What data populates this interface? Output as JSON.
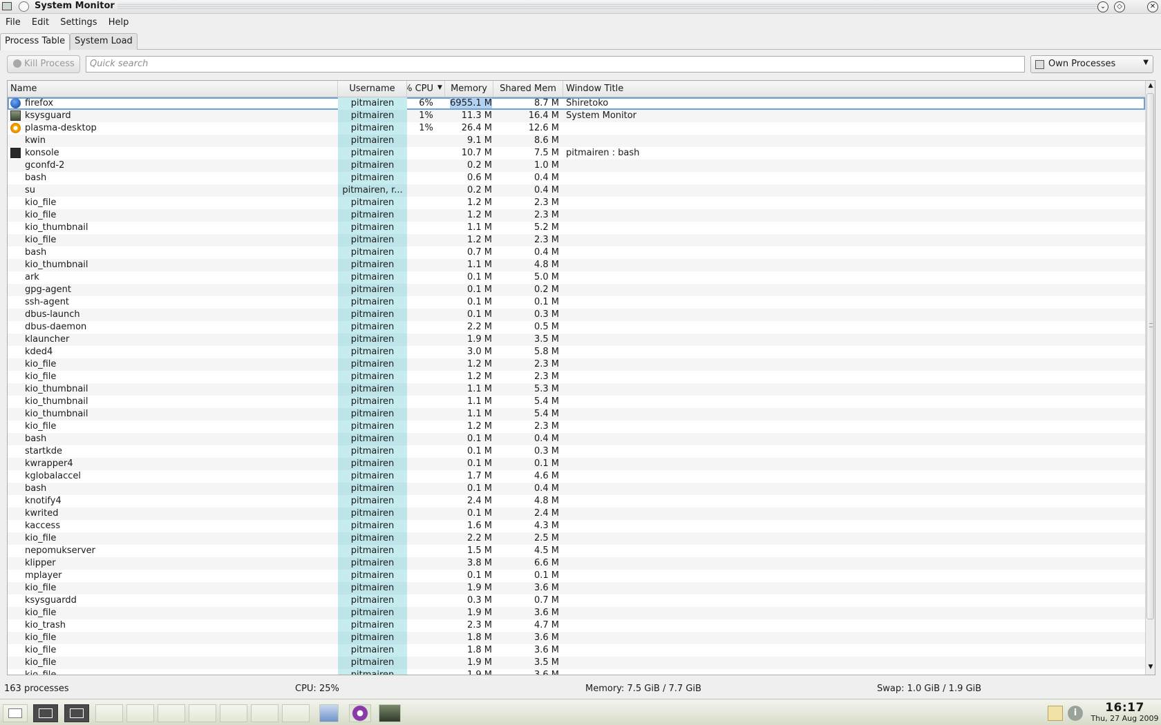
{
  "window": {
    "title": "System Monitor",
    "menu": [
      "File",
      "Edit",
      "Settings",
      "Help"
    ],
    "tabs": [
      "Process Table",
      "System Load"
    ]
  },
  "toolbar": {
    "kill_label": "Kill Process",
    "search_placeholder": "Quick search",
    "filter_value": "Own Processes"
  },
  "table": {
    "headers": {
      "name": "Name",
      "username": "Username",
      "cpu": "CPU %",
      "memory": "Memory",
      "shared": "Shared Mem",
      "window_title": "Window Title"
    },
    "rows": [
      {
        "icon": "firefox-icon",
        "name": "firefox",
        "user": "pitmairen",
        "cpu": "6%",
        "mem": "6955.1 M",
        "shm": "8.7 M",
        "title": "Shiretoko",
        "selected": true
      },
      {
        "icon": "ksysguard-icon",
        "name": "ksysguard",
        "user": "pitmairen",
        "cpu": "1%",
        "mem": "11.3 M",
        "shm": "16.4 M",
        "title": "System Monitor"
      },
      {
        "icon": "plasma-icon",
        "name": "plasma-desktop",
        "user": "pitmairen",
        "cpu": "1%",
        "mem": "26.4 M",
        "shm": "12.6 M",
        "title": ""
      },
      {
        "icon": "",
        "name": "kwin",
        "user": "pitmairen",
        "cpu": "",
        "mem": "9.1 M",
        "shm": "8.6 M",
        "title": ""
      },
      {
        "icon": "konsole-icon",
        "name": "konsole",
        "user": "pitmairen",
        "cpu": "",
        "mem": "10.7 M",
        "shm": "7.5 M",
        "title": "pitmairen : bash"
      },
      {
        "icon": "",
        "name": "gconfd-2",
        "user": "pitmairen",
        "cpu": "",
        "mem": "0.2 M",
        "shm": "1.0 M",
        "title": ""
      },
      {
        "icon": "",
        "name": "bash",
        "user": "pitmairen",
        "cpu": "",
        "mem": "0.6 M",
        "shm": "0.4 M",
        "title": ""
      },
      {
        "icon": "",
        "name": "su",
        "user": "pitmairen, r...",
        "cpu": "",
        "mem": "0.2 M",
        "shm": "0.4 M",
        "title": ""
      },
      {
        "icon": "",
        "name": "kio_file",
        "user": "pitmairen",
        "cpu": "",
        "mem": "1.2 M",
        "shm": "2.3 M",
        "title": ""
      },
      {
        "icon": "",
        "name": "kio_file",
        "user": "pitmairen",
        "cpu": "",
        "mem": "1.2 M",
        "shm": "2.3 M",
        "title": ""
      },
      {
        "icon": "",
        "name": "kio_thumbnail",
        "user": "pitmairen",
        "cpu": "",
        "mem": "1.1 M",
        "shm": "5.2 M",
        "title": ""
      },
      {
        "icon": "",
        "name": "kio_file",
        "user": "pitmairen",
        "cpu": "",
        "mem": "1.2 M",
        "shm": "2.3 M",
        "title": ""
      },
      {
        "icon": "",
        "name": "bash",
        "user": "pitmairen",
        "cpu": "",
        "mem": "0.7 M",
        "shm": "0.4 M",
        "title": ""
      },
      {
        "icon": "",
        "name": "kio_thumbnail",
        "user": "pitmairen",
        "cpu": "",
        "mem": "1.1 M",
        "shm": "4.8 M",
        "title": ""
      },
      {
        "icon": "",
        "name": "ark",
        "user": "pitmairen",
        "cpu": "",
        "mem": "0.1 M",
        "shm": "5.0 M",
        "title": ""
      },
      {
        "icon": "",
        "name": "gpg-agent",
        "user": "pitmairen",
        "cpu": "",
        "mem": "0.1 M",
        "shm": "0.2 M",
        "title": ""
      },
      {
        "icon": "",
        "name": "ssh-agent",
        "user": "pitmairen",
        "cpu": "",
        "mem": "0.1 M",
        "shm": "0.1 M",
        "title": ""
      },
      {
        "icon": "",
        "name": "dbus-launch",
        "user": "pitmairen",
        "cpu": "",
        "mem": "0.1 M",
        "shm": "0.3 M",
        "title": ""
      },
      {
        "icon": "",
        "name": "dbus-daemon",
        "user": "pitmairen",
        "cpu": "",
        "mem": "2.2 M",
        "shm": "0.5 M",
        "title": ""
      },
      {
        "icon": "",
        "name": "klauncher",
        "user": "pitmairen",
        "cpu": "",
        "mem": "1.9 M",
        "shm": "3.5 M",
        "title": ""
      },
      {
        "icon": "",
        "name": "kded4",
        "user": "pitmairen",
        "cpu": "",
        "mem": "3.0 M",
        "shm": "5.8 M",
        "title": ""
      },
      {
        "icon": "",
        "name": "kio_file",
        "user": "pitmairen",
        "cpu": "",
        "mem": "1.2 M",
        "shm": "2.3 M",
        "title": ""
      },
      {
        "icon": "",
        "name": "kio_file",
        "user": "pitmairen",
        "cpu": "",
        "mem": "1.2 M",
        "shm": "2.3 M",
        "title": ""
      },
      {
        "icon": "",
        "name": "kio_thumbnail",
        "user": "pitmairen",
        "cpu": "",
        "mem": "1.1 M",
        "shm": "5.3 M",
        "title": ""
      },
      {
        "icon": "",
        "name": "kio_thumbnail",
        "user": "pitmairen",
        "cpu": "",
        "mem": "1.1 M",
        "shm": "5.4 M",
        "title": ""
      },
      {
        "icon": "",
        "name": "kio_thumbnail",
        "user": "pitmairen",
        "cpu": "",
        "mem": "1.1 M",
        "shm": "5.4 M",
        "title": ""
      },
      {
        "icon": "",
        "name": "kio_file",
        "user": "pitmairen",
        "cpu": "",
        "mem": "1.2 M",
        "shm": "2.3 M",
        "title": ""
      },
      {
        "icon": "",
        "name": "bash",
        "user": "pitmairen",
        "cpu": "",
        "mem": "0.1 M",
        "shm": "0.4 M",
        "title": ""
      },
      {
        "icon": "",
        "name": "startkde",
        "user": "pitmairen",
        "cpu": "",
        "mem": "0.1 M",
        "shm": "0.3 M",
        "title": ""
      },
      {
        "icon": "",
        "name": "kwrapper4",
        "user": "pitmairen",
        "cpu": "",
        "mem": "0.1 M",
        "shm": "0.1 M",
        "title": ""
      },
      {
        "icon": "",
        "name": "kglobalaccel",
        "user": "pitmairen",
        "cpu": "",
        "mem": "1.7 M",
        "shm": "4.6 M",
        "title": ""
      },
      {
        "icon": "",
        "name": "bash",
        "user": "pitmairen",
        "cpu": "",
        "mem": "0.1 M",
        "shm": "0.4 M",
        "title": ""
      },
      {
        "icon": "",
        "name": "knotify4",
        "user": "pitmairen",
        "cpu": "",
        "mem": "2.4 M",
        "shm": "4.8 M",
        "title": ""
      },
      {
        "icon": "",
        "name": "kwrited",
        "user": "pitmairen",
        "cpu": "",
        "mem": "0.1 M",
        "shm": "2.4 M",
        "title": ""
      },
      {
        "icon": "",
        "name": "kaccess",
        "user": "pitmairen",
        "cpu": "",
        "mem": "1.6 M",
        "shm": "4.3 M",
        "title": ""
      },
      {
        "icon": "",
        "name": "kio_file",
        "user": "pitmairen",
        "cpu": "",
        "mem": "2.2 M",
        "shm": "2.5 M",
        "title": ""
      },
      {
        "icon": "",
        "name": "nepomukserver",
        "user": "pitmairen",
        "cpu": "",
        "mem": "1.5 M",
        "shm": "4.5 M",
        "title": ""
      },
      {
        "icon": "",
        "name": "klipper",
        "user": "pitmairen",
        "cpu": "",
        "mem": "3.8 M",
        "shm": "6.6 M",
        "title": ""
      },
      {
        "icon": "",
        "name": "mplayer",
        "user": "pitmairen",
        "cpu": "",
        "mem": "0.1 M",
        "shm": "0.1 M",
        "title": ""
      },
      {
        "icon": "",
        "name": "kio_file",
        "user": "pitmairen",
        "cpu": "",
        "mem": "1.9 M",
        "shm": "3.6 M",
        "title": ""
      },
      {
        "icon": "",
        "name": "ksysguardd",
        "user": "pitmairen",
        "cpu": "",
        "mem": "0.3 M",
        "shm": "0.7 M",
        "title": ""
      },
      {
        "icon": "",
        "name": "kio_file",
        "user": "pitmairen",
        "cpu": "",
        "mem": "1.9 M",
        "shm": "3.6 M",
        "title": ""
      },
      {
        "icon": "",
        "name": "kio_trash",
        "user": "pitmairen",
        "cpu": "",
        "mem": "2.3 M",
        "shm": "4.7 M",
        "title": ""
      },
      {
        "icon": "",
        "name": "kio_file",
        "user": "pitmairen",
        "cpu": "",
        "mem": "1.8 M",
        "shm": "3.6 M",
        "title": ""
      },
      {
        "icon": "",
        "name": "kio_file",
        "user": "pitmairen",
        "cpu": "",
        "mem": "1.8 M",
        "shm": "3.6 M",
        "title": ""
      },
      {
        "icon": "",
        "name": "kio_file",
        "user": "pitmairen",
        "cpu": "",
        "mem": "1.9 M",
        "shm": "3.5 M",
        "title": ""
      },
      {
        "icon": "",
        "name": "kio_file",
        "user": "pitmairen",
        "cpu": "",
        "mem": "1.9 M",
        "shm": "3.6 M",
        "title": ""
      }
    ]
  },
  "status": {
    "processes": "163 processes",
    "cpu": "CPU: 25%",
    "memory": "Memory: 7.5 GiB / 7.7 GiB",
    "swap": "Swap: 1.0 GiB / 1.9 GiB"
  },
  "taskbar": {
    "time": "16:17",
    "date": "Thu, 27 Aug 2009"
  },
  "colors": {
    "selection_outline": "#6e9fd6",
    "sorted_column": "#c7ecf0"
  }
}
